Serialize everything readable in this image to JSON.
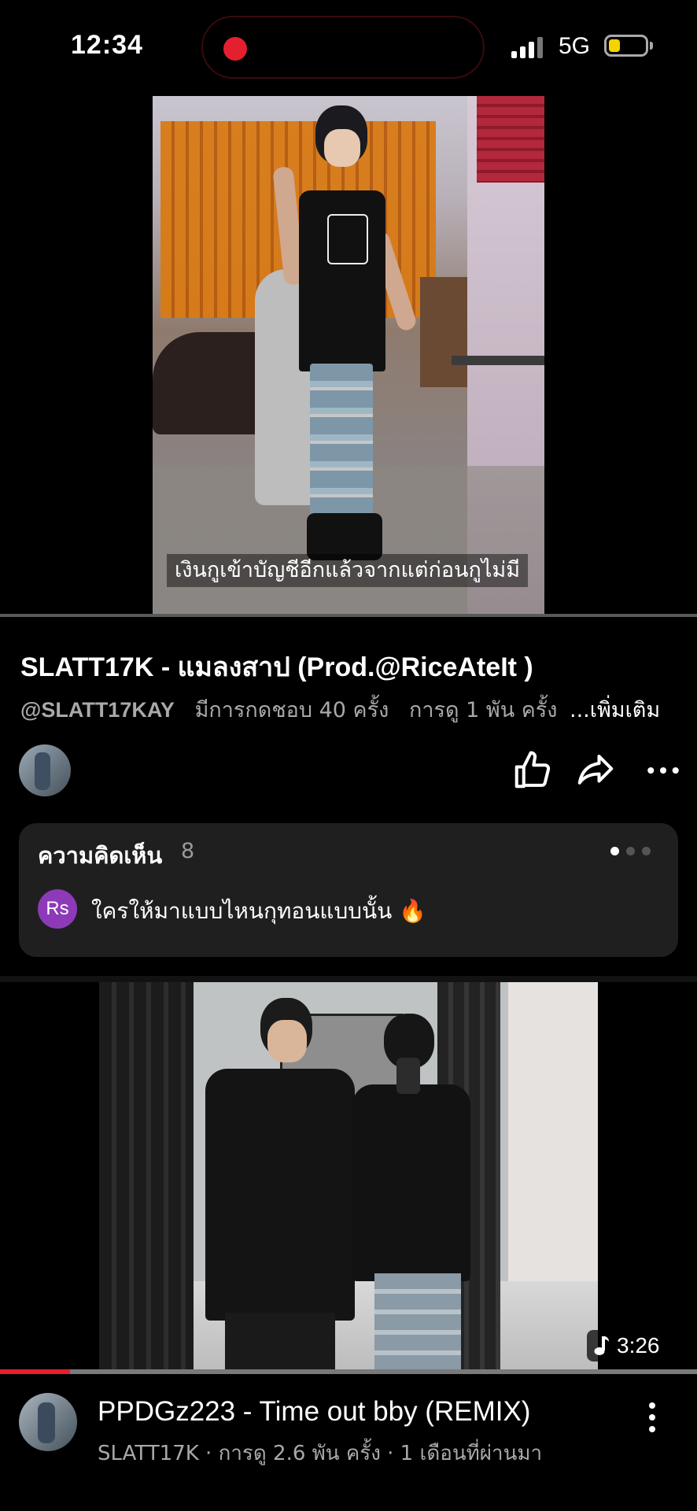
{
  "status_bar": {
    "time": "12:34",
    "network": "5G",
    "signal_bars": 4,
    "battery_level_fraction": 0.25,
    "recording": true
  },
  "current_video": {
    "subtitle": "เงินกูเข้าบัญชีอีกแล้วจากแต่ก่อนกูไม่มี",
    "title": "SLATT17K - แมลงสาป (Prod.@RiceAteIt )",
    "channel_handle": "@SLATT17KAY",
    "likes_text": "มีการกดชอบ 40 ครั้ง",
    "views_text": "การดู 1 พัน ครั้ง",
    "more_label": "...เพิ่มเติม",
    "actions": [
      "like",
      "share",
      "more"
    ]
  },
  "comments": {
    "title": "ความคิดเห็น",
    "count": "8",
    "carousel_pages": 3,
    "carousel_active": 0,
    "top_comment": {
      "avatar_initials": "Rs",
      "text": "ใครให้มาแบบไหนกุทอนแบบนั้น 🔥"
    }
  },
  "next_video": {
    "duration": "3:26",
    "watched_fraction": 0.1,
    "title": "PPDGz223 - Time out bby (REMIX)",
    "meta": "SLATT17K · การดู 2.6 พัน ครั้ง · 1 เดือนที่ผ่านมา"
  },
  "colors": {
    "accent_red": "#e5202e",
    "battery_yellow": "#f6d200",
    "card_bg": "#1f1f1f",
    "avatar_purple": "#8d3ab8",
    "muted_text": "#a9a9a9"
  }
}
